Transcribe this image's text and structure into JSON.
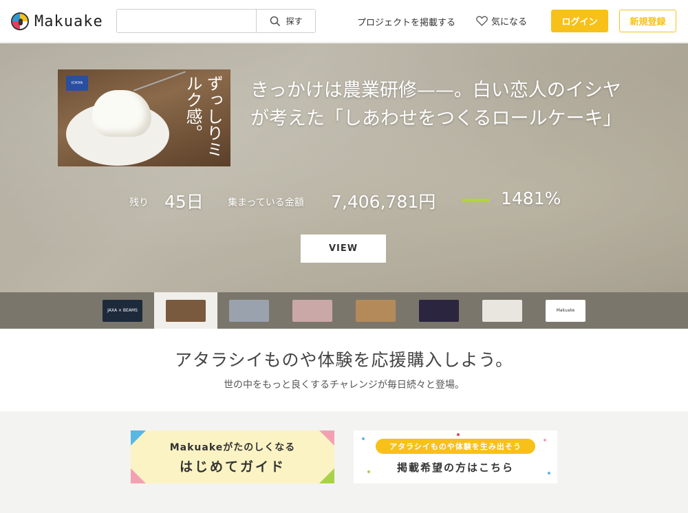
{
  "header": {
    "logo_text": "Makuake",
    "search": {
      "value": "",
      "placeholder": "",
      "button_label": "探す"
    },
    "nav_post": "プロジェクトを掲載する",
    "nav_favorite": "気になる",
    "login_label": "ログイン",
    "register_label": "新規登録"
  },
  "hero": {
    "thumb_badge": "ICHIYA",
    "thumb_text": "ずっしりミルク感。",
    "title": "きっかけは農業研修——。白い恋人のイシヤが考えた「しあわせをつくるロールケーキ」",
    "remaining_label": "残り",
    "remaining_value": "45日",
    "funded_label": "集まっている金額",
    "funded_value": "7,406,781円",
    "progress_percent": "1481%",
    "progress_fraction": 1.0,
    "view_label": "VIEW"
  },
  "strip": {
    "items": [
      {
        "label": "JAXA × BEAMS",
        "color": "#1d2a3c"
      },
      {
        "label": "",
        "color": "#7a5a3e"
      },
      {
        "label": "",
        "color": "#9aa3ad"
      },
      {
        "label": "",
        "color": "#caa8a8"
      },
      {
        "label": "",
        "color": "#b58a5a"
      },
      {
        "label": "",
        "color": "#2b2540"
      },
      {
        "label": "",
        "color": "#e9e6e0"
      },
      {
        "label": "Makuake",
        "color": "#ffffff"
      }
    ],
    "active_index": 1
  },
  "tagline": {
    "main": "アタラシイものや体験を応援購入しよう。",
    "sub": "世の中をもっと良くするチャレンジが毎日続々と登場。"
  },
  "banners": {
    "guide_line1": "Makuakeがたのしくなる",
    "guide_line2": "はじめてガイド",
    "post_pill": "アタラシイものや体験を生み出そう",
    "post_line2": "掲載希望の方はこちら"
  },
  "colors": {
    "accent": "#f7c11a",
    "progress": "#b4d43c"
  }
}
